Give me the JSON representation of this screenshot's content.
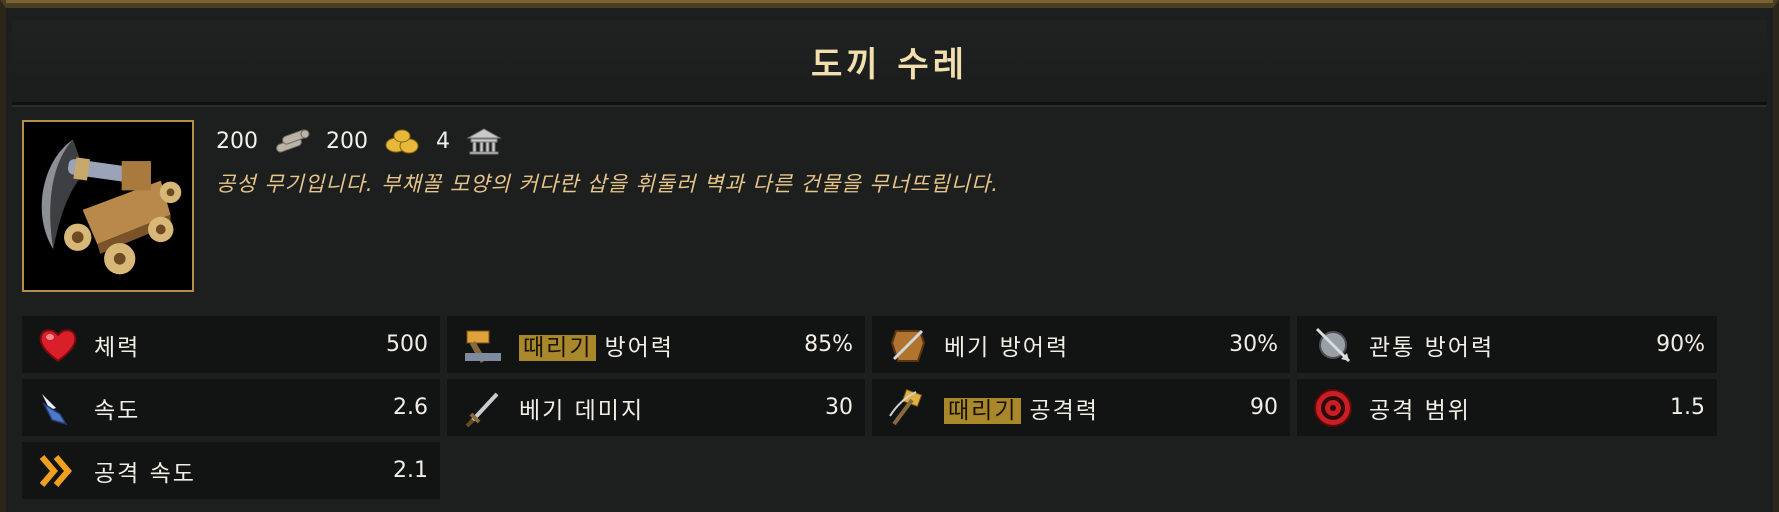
{
  "unit": {
    "name": "도끼 수레",
    "description": "공성 무기입니다. 부채꼴 모양의 커다란 삽을 휘둘러 벽과 다른 건물을 무너뜨립니다.",
    "portrait_icon": "axe-cart-portrait"
  },
  "cost": {
    "wood": "200",
    "wood_icon": "wood-logs-icon",
    "gold": "200",
    "gold_icon": "gold-nuggets-icon",
    "population": "4",
    "population_icon": "house-icon"
  },
  "stats": [
    {
      "icon": "heart-icon",
      "highlight": "",
      "label": "체력",
      "value": "500"
    },
    {
      "icon": "hammer-armor-icon",
      "highlight": "때리기",
      "label": "방어력",
      "value": "85%"
    },
    {
      "icon": "leather-armor-icon",
      "highlight": "",
      "label": "베기 방어력",
      "value": "30%"
    },
    {
      "icon": "shield-arrow-icon",
      "highlight": "",
      "label": "관통 방어력",
      "value": "90%"
    },
    {
      "icon": "winged-boot-icon",
      "highlight": "",
      "label": "속도",
      "value": "2.6"
    },
    {
      "icon": "sword-icon",
      "highlight": "",
      "label": "베기 데미지",
      "value": "30"
    },
    {
      "icon": "hammer-swing-icon",
      "highlight": "때리기",
      "label": "공격력",
      "value": "90"
    },
    {
      "icon": "target-icon",
      "highlight": "",
      "label": "공격 범위",
      "value": "1.5"
    },
    {
      "icon": "chevrons-icon",
      "highlight": "",
      "label": "공격 속도",
      "value": "2.1"
    }
  ],
  "colors": {
    "title": "#f3dfae",
    "description": "#e7c489",
    "highlight": "#a8882a",
    "stat_bg": "#121413",
    "portrait_border": "#b58f4a"
  }
}
